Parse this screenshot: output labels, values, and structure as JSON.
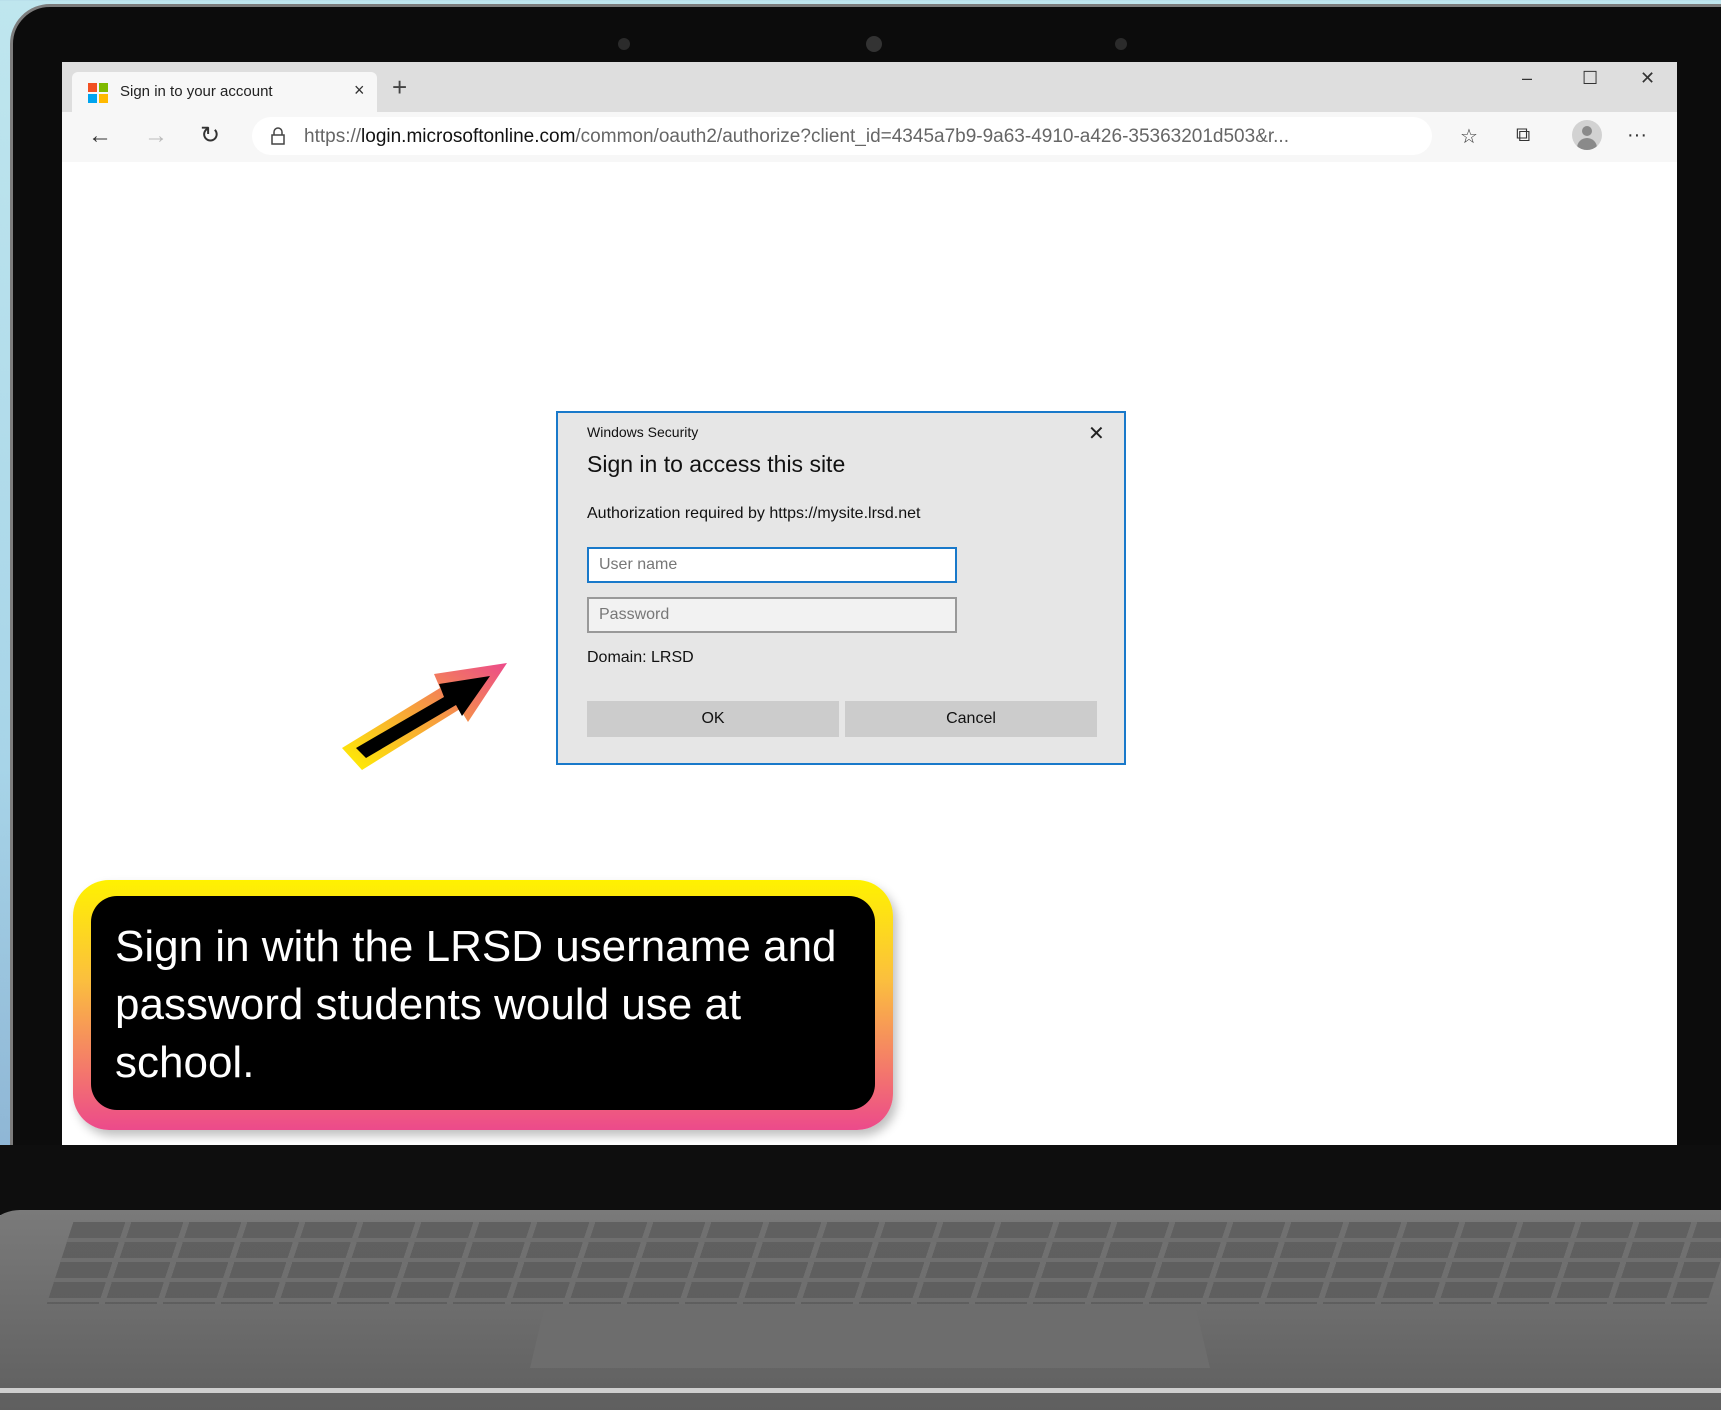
{
  "browser": {
    "tab_title": "Sign in to your account",
    "tab_close": "×",
    "new_tab": "+",
    "window_controls": {
      "minimize": "–",
      "maximize": "☐",
      "close": "✕"
    },
    "nav": {
      "back": "←",
      "forward": "→",
      "refresh": "↻"
    },
    "url_scheme": "https://",
    "url_host": "login.microsoftonline.com",
    "url_path": "/common/oauth2/authorize?client_id=4345a7b9-9a63-4910-a426-35363201d503&r...",
    "toolbar": {
      "favorites": "☆",
      "collections": "⧉",
      "more": "···"
    }
  },
  "dialog": {
    "caption": "Windows Security",
    "close": "✕",
    "title": "Sign in to access this site",
    "authorization": "Authorization required by https://mysite.lrsd.net",
    "username_placeholder": "User name",
    "password_placeholder": "Password",
    "domain": "Domain: LRSD",
    "ok_label": "OK",
    "cancel_label": "Cancel"
  },
  "callout": {
    "text": "Sign in with the LRSD username and password students would use at school."
  },
  "colors": {
    "dialog_border": "#1979ca",
    "callout_gradient": [
      "#fff200",
      "#fbbf3e",
      "#f47a6a",
      "#ec4a8b"
    ],
    "arrow_gradient": [
      "#fff200",
      "#f7a13b",
      "#ec4a8b"
    ],
    "ms_logo": [
      "#f25022",
      "#7fba00",
      "#00a4ef",
      "#ffb900"
    ]
  },
  "icons": [
    "microsoft-logo-icon",
    "lock-icon",
    "favorites-icon",
    "collections-icon",
    "profile-icon",
    "more-icon",
    "pointer-arrow-icon"
  ]
}
